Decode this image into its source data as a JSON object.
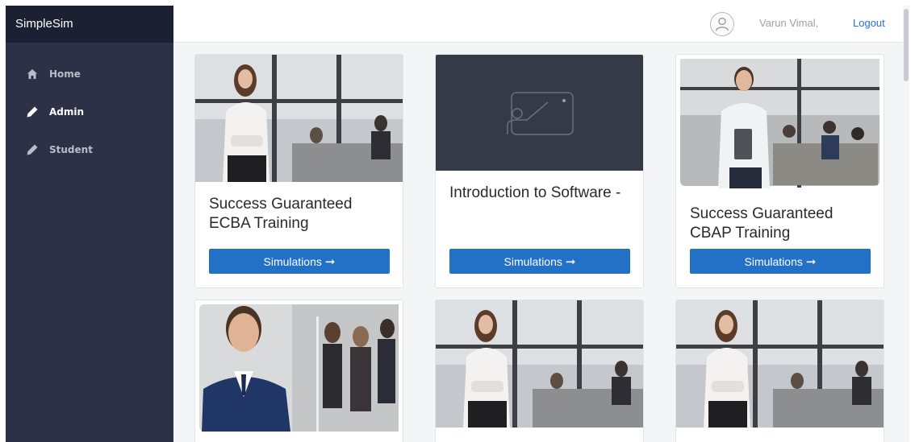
{
  "app": {
    "title": "SimpleSim"
  },
  "sidebar": {
    "items": [
      {
        "label": "Home",
        "icon": "home-icon",
        "active": false
      },
      {
        "label": "Admin",
        "icon": "pencil-icon",
        "active": true
      },
      {
        "label": "Student",
        "icon": "pencil-icon",
        "active": false
      }
    ]
  },
  "header": {
    "user_name": "Varun Vimal,",
    "logout_label": "Logout"
  },
  "cards": [
    {
      "title": "Success Guaranteed ECBA Training",
      "button_label": "Simulations",
      "image": "woman-in-office-photo"
    },
    {
      "title": "Introduction to Software -",
      "button_label": "Simulations",
      "image": "presentation-placeholder-icon"
    },
    {
      "title": "Success Guaranteed CBAP Training",
      "button_label": "Simulations",
      "image": "man-in-office-photo"
    },
    {
      "title": "",
      "button_label": "",
      "image": "businessman-photo"
    },
    {
      "title": "",
      "button_label": "",
      "image": "woman-in-office-photo"
    },
    {
      "title": "",
      "button_label": "",
      "image": "woman-in-office-photo"
    }
  ],
  "colors": {
    "sidebar": "#2c3148",
    "brand": "#1c2033",
    "button": "#2371c7",
    "link": "#2a6fcf"
  }
}
